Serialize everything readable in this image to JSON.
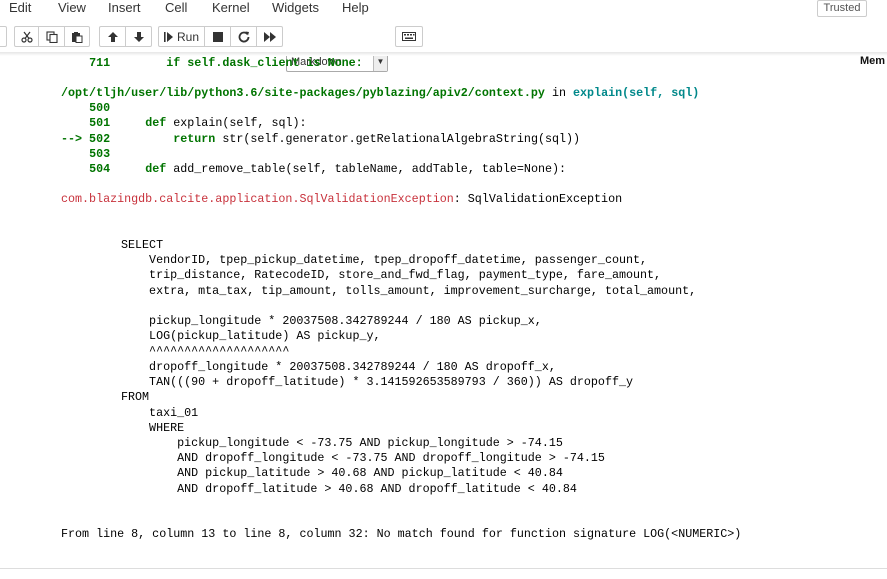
{
  "menu": {
    "items": [
      "Edit",
      "View",
      "Insert",
      "Cell",
      "Kernel",
      "Widgets",
      "Help"
    ],
    "trusted": "Trusted"
  },
  "toolbar": {
    "run_label": "Run",
    "cell_type": "Markdown",
    "memory_label": "Mem"
  },
  "traceback": {
    "line711_num": "711",
    "line711_a": "if ",
    "line711_b": "self",
    "line711_c": ".dask_client ",
    "line711_d": "is ",
    "line711_e": "None:",
    "file_path": "/opt/tljh/user/lib/python3.6/site-packages/pyblazing/apiv2/context.py",
    "in_word": " in ",
    "func_sig": "explain(self, sql)",
    "line500": "500",
    "line501": "501",
    "line501_code_a": "def ",
    "line501_code_b": "explain(self, sql):",
    "arrow": "--> 502",
    "line502_code_a": "return ",
    "line502_code_b": "str(self.generator.getRelationalAlgebraString(sql))",
    "line503": "503",
    "line504": "504",
    "line504_code_a": "def ",
    "line504_code_b": "add_remove_table(self, tableName, addTable, table=None):",
    "exception_class": "com.blazingdb.calcite.application.SqlValidationException",
    "exception_msg": ": SqlValidationException"
  },
  "sql": [
    "SELECT",
    "    VendorID, tpep_pickup_datetime, tpep_dropoff_datetime, passenger_count,",
    "    trip_distance, RatecodeID, store_and_fwd_flag, payment_type, fare_amount,",
    "    extra, mta_tax, tip_amount, tolls_amount, improvement_surcharge, total_amount,",
    "",
    "    pickup_longitude * 20037508.342789244 / 180 AS pickup_x,",
    "    LOG(pickup_latitude) AS pickup_y,",
    "    ^^^^^^^^^^^^^^^^^^^^",
    "    dropoff_longitude * 20037508.342789244 / 180 AS dropoff_x,",
    "    TAN(((90 + dropoff_latitude) * 3.141592653589793 / 360)) AS dropoff_y",
    "FROM",
    "    taxi_01",
    "    WHERE",
    "        pickup_longitude < -73.75 AND pickup_longitude > -74.15",
    "        AND dropoff_longitude < -73.75 AND dropoff_longitude > -74.15",
    "        AND pickup_latitude > 40.68 AND pickup_latitude < 40.84",
    "        AND dropoff_latitude > 40.68 AND dropoff_latitude < 40.84"
  ],
  "error_footer": "From line 8, column 13 to line 8, column 32: No match found for function signature LOG(<NUMERIC>)",
  "icons": [
    "scissors-icon",
    "copy-icon",
    "paste-icon",
    "arrow-up-icon",
    "arrow-down-icon",
    "run-icon",
    "stop-icon",
    "restart-icon",
    "fast-forward-icon",
    "keyboard-icon",
    "dropdown-arrow-icon"
  ]
}
